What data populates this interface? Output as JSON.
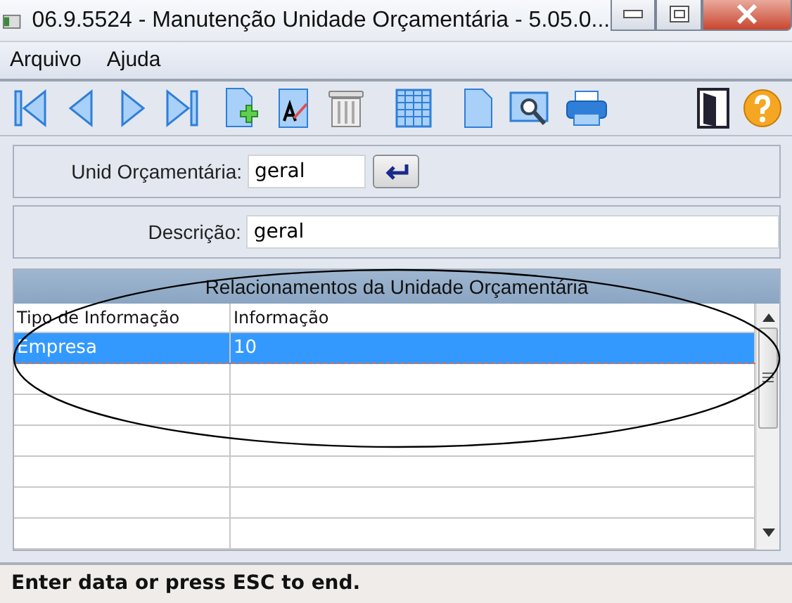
{
  "window": {
    "title": "06.9.5524 - Manutenção Unidade Orçamentária - 5.05.0..."
  },
  "menu": [
    {
      "label": "Arquivo"
    },
    {
      "label": "Ajuda"
    }
  ],
  "form": {
    "unit": {
      "label": "Unid Orçamentária:",
      "value": "geral"
    },
    "description": {
      "label": "Descrição:",
      "value": "geral"
    }
  },
  "grid": {
    "title": "Relacionamentos da Unidade Orçamentária",
    "columns": [
      "Tipo de Informação",
      "Informação"
    ],
    "rows": [
      {
        "cells": [
          "Empresa",
          "10"
        ],
        "selected": true
      }
    ]
  },
  "status_bar": "Enter data or press ESC to end."
}
